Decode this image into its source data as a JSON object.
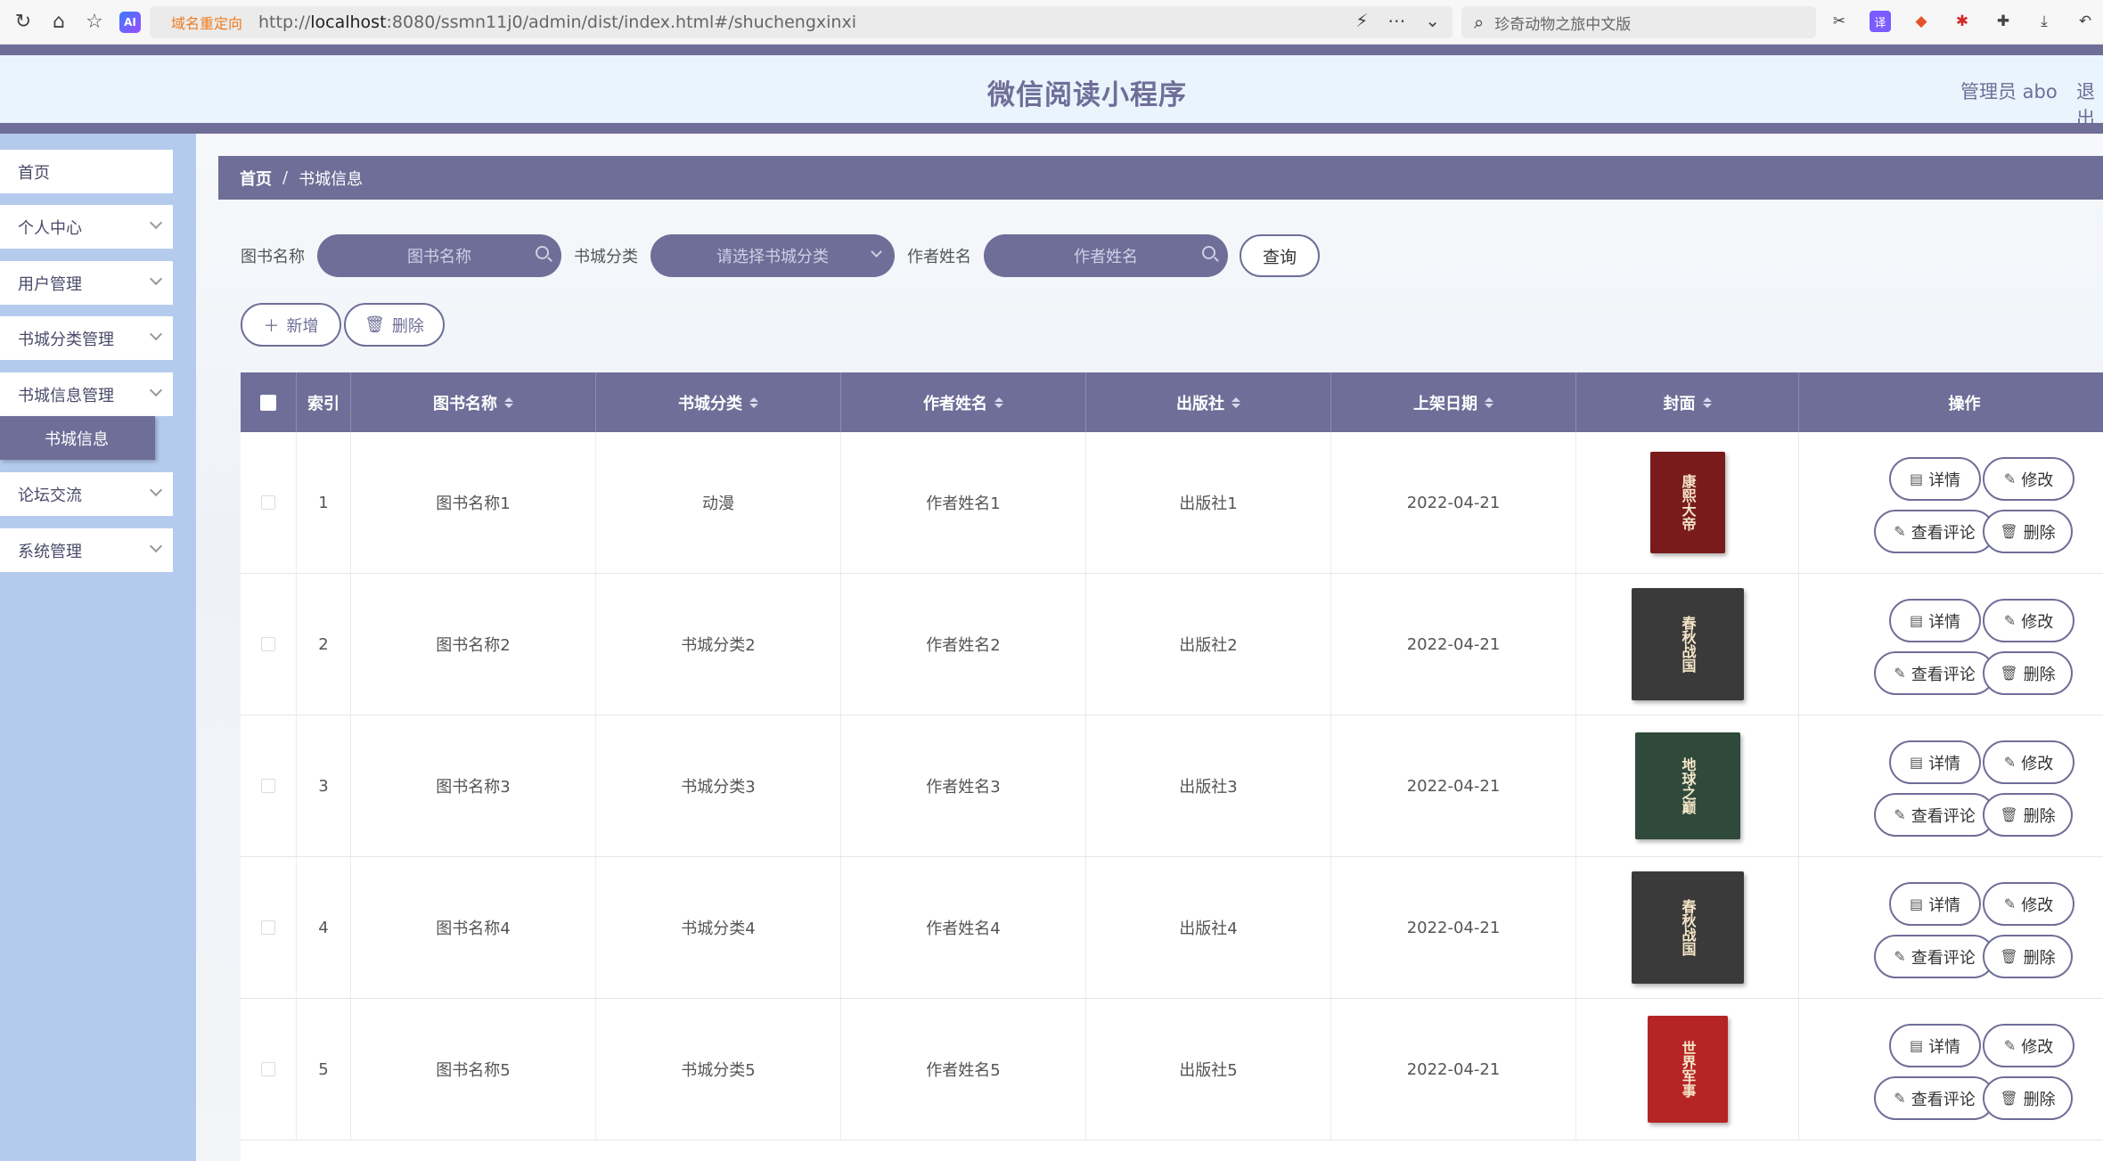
{
  "browser": {
    "redirect_label": "域名重定向",
    "url_prefix": "http://",
    "url_host": "localhost",
    "url_rest": ":8080/ssmn11j0/admin/dist/index.html#/shuchengxinxi",
    "search_text": "珍奇动物之旅中文版",
    "ai_label": "AI"
  },
  "header": {
    "title": "微信阅读小程序",
    "admin_label": "管理员 abo",
    "logout_label": "退出"
  },
  "sidebar": {
    "items": [
      {
        "label": "首页"
      },
      {
        "label": "个人中心"
      },
      {
        "label": "用户管理"
      },
      {
        "label": "书城分类管理"
      },
      {
        "label": "书城信息管理"
      },
      {
        "label": "论坛交流"
      },
      {
        "label": "系统管理"
      }
    ],
    "active_sub": "书城信息"
  },
  "breadcrumb": {
    "home": "首页",
    "sep": "/",
    "current": "书城信息"
  },
  "search": {
    "name_label": "图书名称",
    "name_placeholder": "图书名称",
    "cat_label": "书城分类",
    "cat_placeholder": "请选择书城分类",
    "author_label": "作者姓名",
    "author_placeholder": "作者姓名",
    "query_label": "查询"
  },
  "toolbar": {
    "add_label": "新增",
    "delete_label": "删除"
  },
  "table": {
    "headers": {
      "index": "索引",
      "name": "图书名称",
      "category": "书城分类",
      "author": "作者姓名",
      "publisher": "出版社",
      "date": "上架日期",
      "cover": "封面",
      "actions": "操作"
    },
    "action_labels": {
      "detail": "详情",
      "edit": "修改",
      "comments": "查看评论",
      "delete": "删除"
    },
    "rows": [
      {
        "index": "1",
        "name": "图书名称1",
        "category": "动漫",
        "author": "作者姓名1",
        "publisher": "出版社1",
        "date": "2022-04-21",
        "cover_text": "康熙大帝",
        "cover_color": "#7a1b1b"
      },
      {
        "index": "2",
        "name": "图书名称2",
        "category": "书城分类2",
        "author": "作者姓名2",
        "publisher": "出版社2",
        "date": "2022-04-21",
        "cover_text": "春秋战国",
        "cover_color": "#3a3a3a"
      },
      {
        "index": "3",
        "name": "图书名称3",
        "category": "书城分类3",
        "author": "作者姓名3",
        "publisher": "出版社3",
        "date": "2022-04-21",
        "cover_text": "地球之巅",
        "cover_color": "#2f4a3a"
      },
      {
        "index": "4",
        "name": "图书名称4",
        "category": "书城分类4",
        "author": "作者姓名4",
        "publisher": "出版社4",
        "date": "2022-04-21",
        "cover_text": "春秋战国",
        "cover_color": "#3a3a3a"
      },
      {
        "index": "5",
        "name": "图书名称5",
        "category": "书城分类5",
        "author": "作者姓名5",
        "publisher": "出版社5",
        "date": "2022-04-21",
        "cover_text": "世界军事",
        "cover_color": "#b52525"
      }
    ]
  }
}
